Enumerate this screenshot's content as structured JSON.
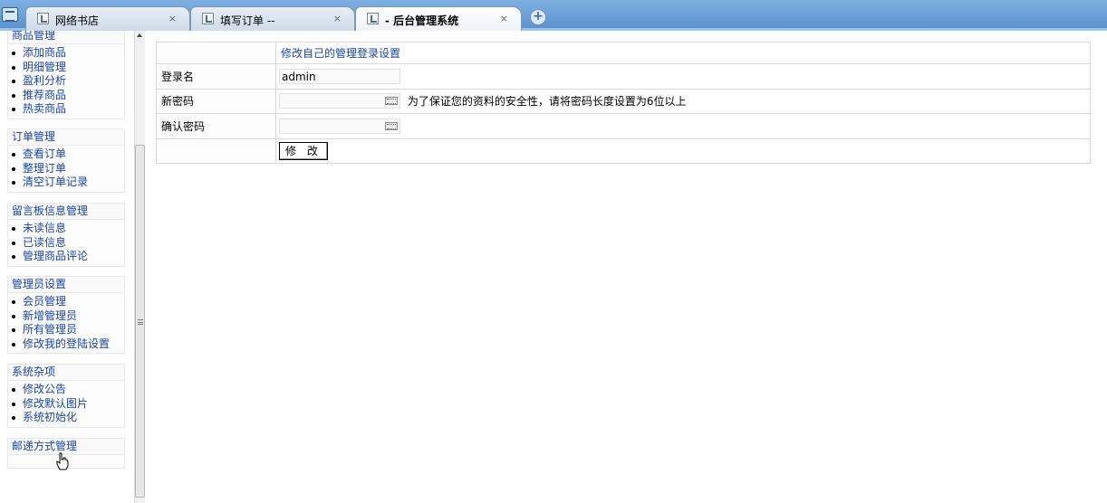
{
  "browser": {
    "tabs": [
      {
        "label": "网络书店",
        "close": "×"
      },
      {
        "label": "填写订单 --",
        "close": "×"
      },
      {
        "label": "- 后台管理系统",
        "close": "×"
      }
    ],
    "new_tab": "+"
  },
  "sidebar": {
    "groups": [
      {
        "title": "商品管理",
        "items": [
          "添加商品",
          "明细管理",
          "盈利分析",
          "推荐商品",
          "热卖商品"
        ]
      },
      {
        "title": "订单管理",
        "items": [
          "查看订单",
          "整理订单",
          "清空订单记录"
        ]
      },
      {
        "title": "留言板信息管理",
        "items": [
          "未读信息",
          "已读信息",
          "管理商品评论"
        ]
      },
      {
        "title": "管理员设置",
        "items": [
          "会员管理",
          "新增管理员",
          "所有管理员",
          "修改我的登陆设置"
        ]
      },
      {
        "title": "系统杂项",
        "items": [
          "修改公告",
          "修改默认图片",
          "系统初始化"
        ]
      },
      {
        "title": "邮递方式管理",
        "items": []
      }
    ]
  },
  "form": {
    "caption": "修改自己的管理登录设置",
    "login_label": "登录名",
    "login_value": "admin",
    "new_password_label": "新密码",
    "password_hint": "为了保证您的资料的安全性，请将密码长度设置为6位以上",
    "confirm_password_label": "确认密码",
    "submit_label": "修 改"
  }
}
